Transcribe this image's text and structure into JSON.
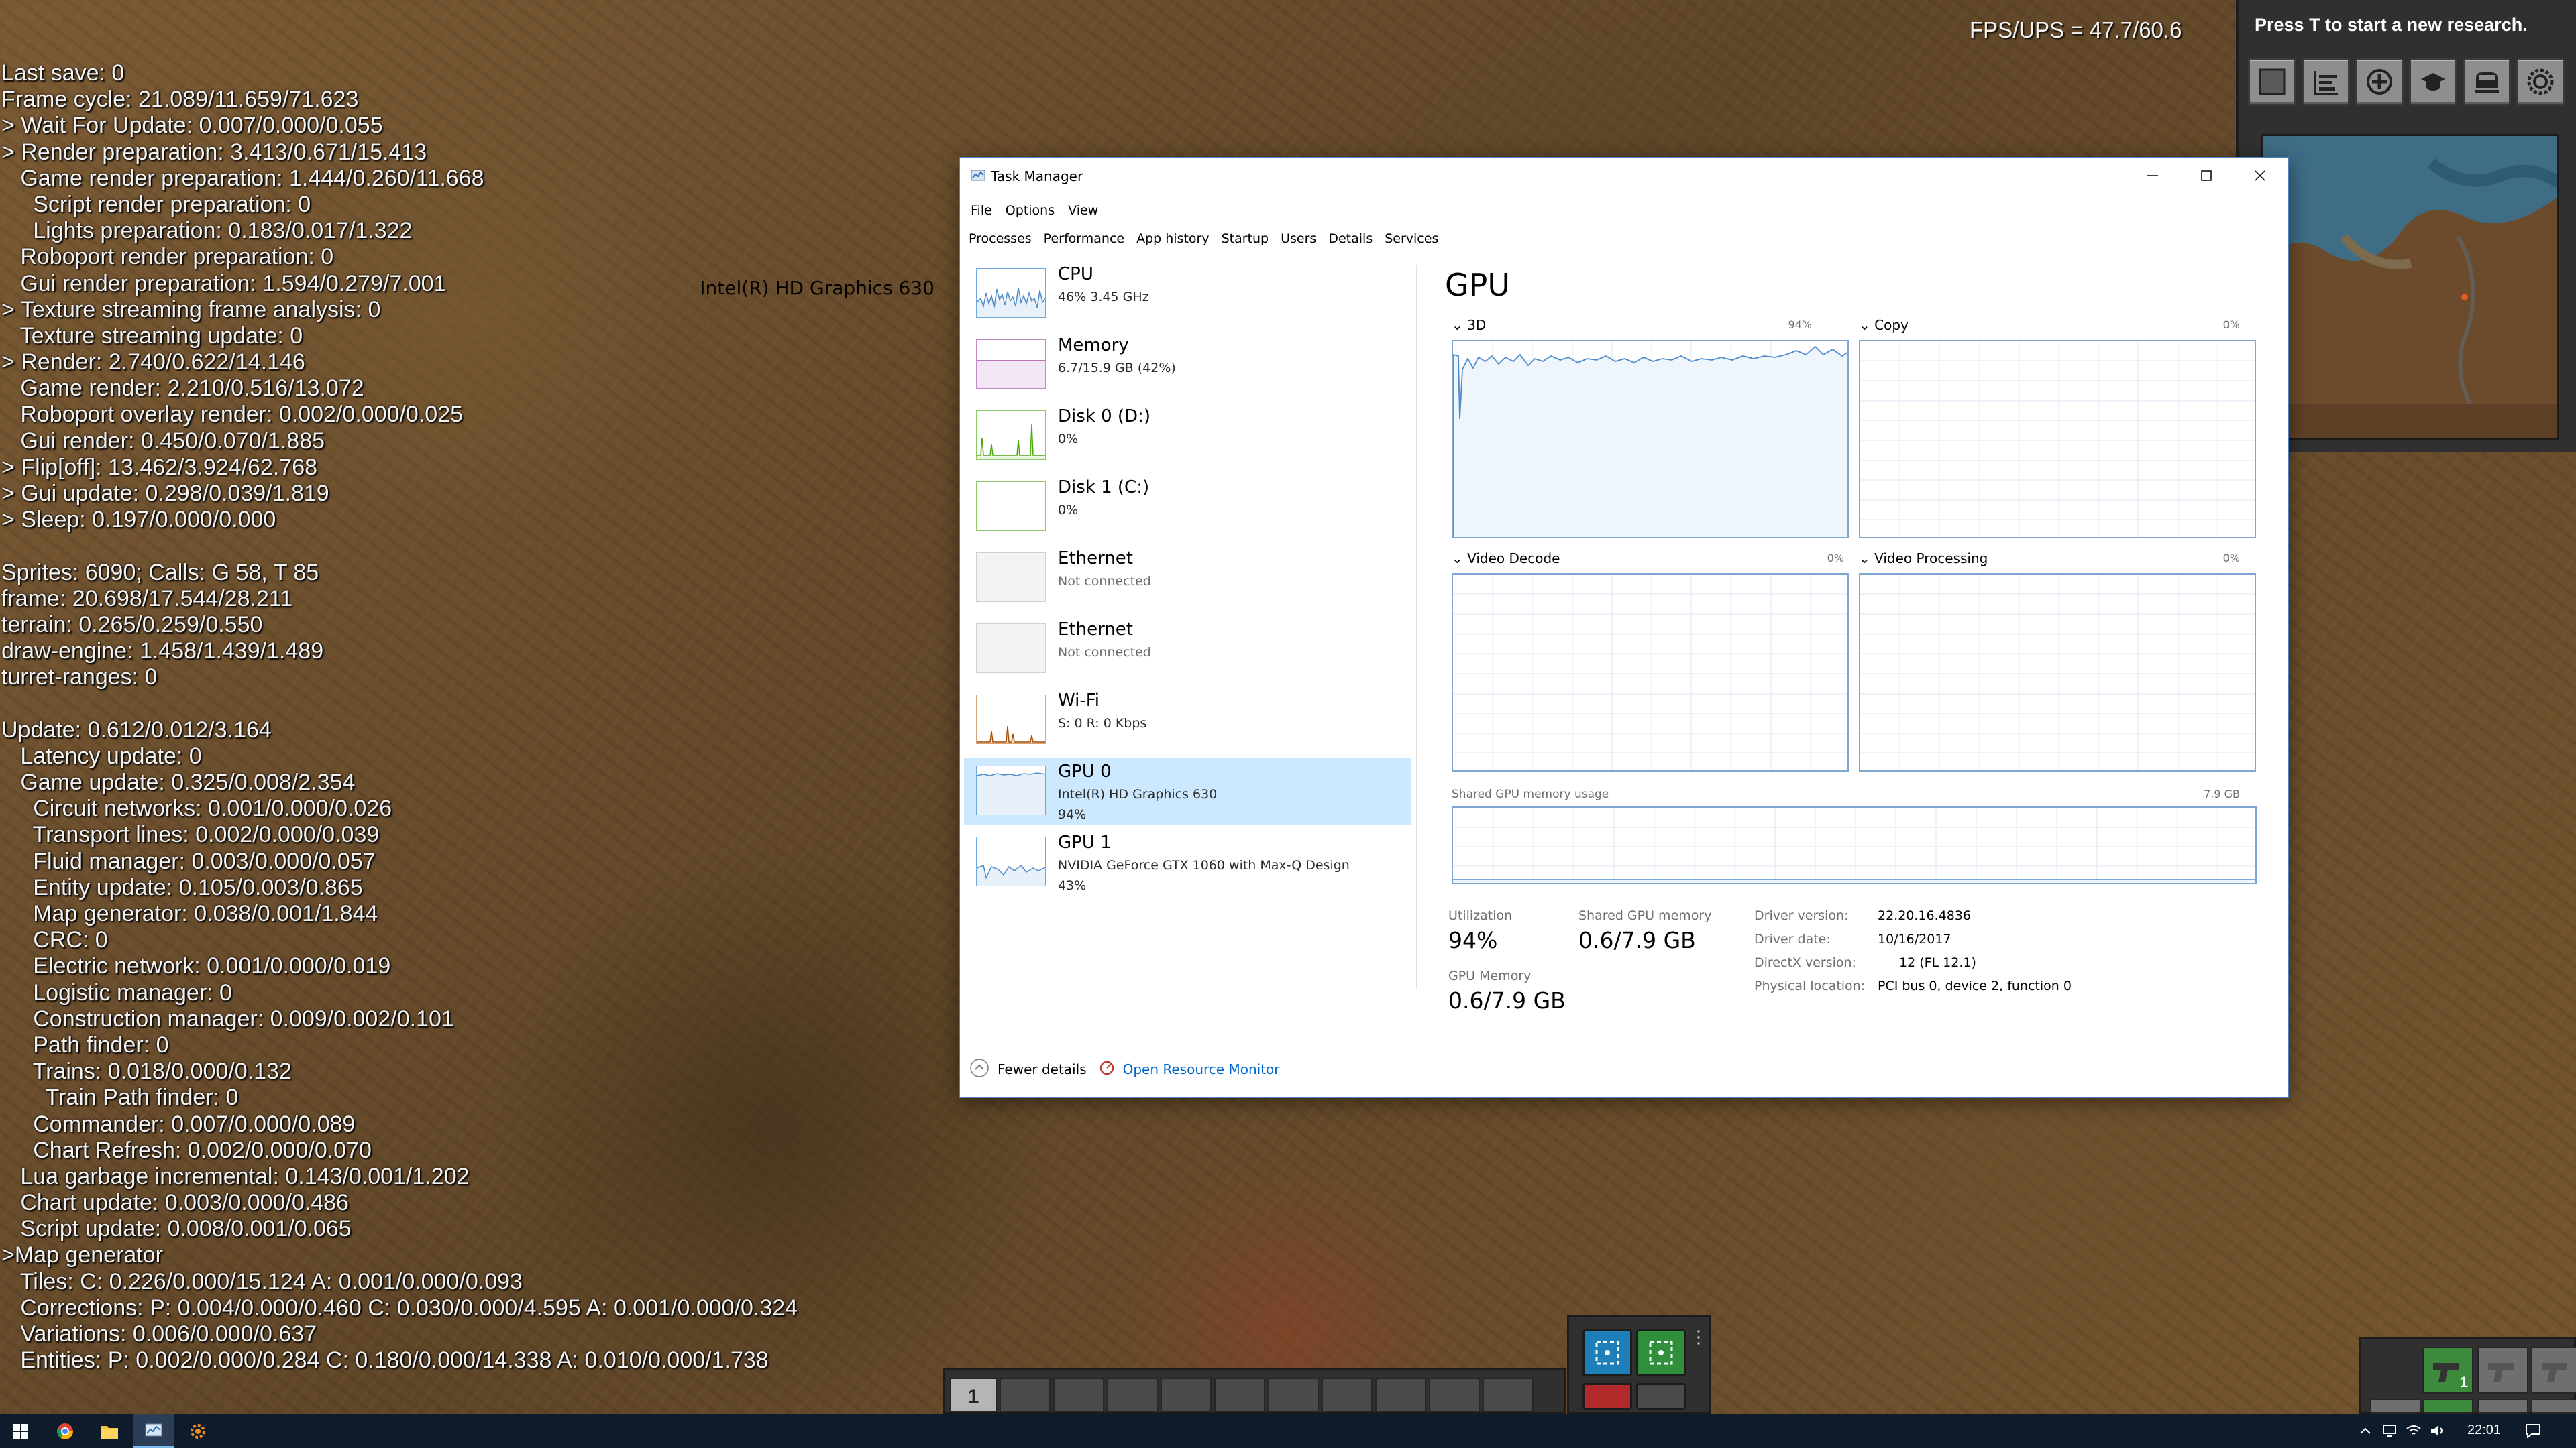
{
  "game": {
    "fps": "FPS/UPS = 47.7/60.6",
    "research_prompt": "Press T to start a new research.",
    "debug_lines": [
      "Last save: 0",
      "Frame cycle: 21.089/11.659/71.623",
      "> Wait For Update: 0.007/0.000/0.055",
      "> Render preparation: 3.413/0.671/15.413",
      "   Game render preparation: 1.444/0.260/11.668",
      "     Script render preparation: 0",
      "     Lights preparation: 0.183/0.017/1.322",
      "   Roboport render preparation: 0",
      "   Gui render preparation: 1.594/0.279/7.001",
      "> Texture streaming frame analysis: 0",
      "   Texture streaming update: 0",
      "> Render: 2.740/0.622/14.146",
      "   Game render: 2.210/0.516/13.072",
      "   Roboport overlay render: 0.002/0.000/0.025",
      "   Gui render: 0.450/0.070/1.885",
      "> Flip[off]: 13.462/3.924/62.768",
      "> Gui update: 0.298/0.039/1.819",
      "> Sleep: 0.197/0.000/0.000",
      "",
      "Sprites: 6090; Calls: G 58, T 85",
      "frame: 20.698/17.544/28.211",
      "terrain: 0.265/0.259/0.550",
      "draw-engine: 1.458/1.439/1.489",
      "turret-ranges: 0",
      "",
      "Update: 0.612/0.012/3.164",
      "   Latency update: 0",
      "   Game update: 0.325/0.008/2.354",
      "     Circuit networks: 0.001/0.000/0.026",
      "     Transport lines: 0.002/0.000/0.039",
      "     Fluid manager: 0.003/0.000/0.057",
      "     Entity update: 0.105/0.003/0.865",
      "     Map generator: 0.038/0.001/1.844",
      "     CRC: 0",
      "     Electric network: 0.001/0.000/0.019",
      "     Logistic manager: 0",
      "     Construction manager: 0.009/0.002/0.101",
      "     Path finder: 0",
      "     Trains: 0.018/0.000/0.132",
      "       Train Path finder: 0",
      "     Commander: 0.007/0.000/0.089",
      "     Chart Refresh: 0.002/0.000/0.070",
      "   Lua garbage incremental: 0.143/0.001/1.202",
      "   Chart update: 0.003/0.000/0.486",
      "   Script update: 0.008/0.001/0.065",
      ">Map generator",
      "   Tiles: C: 0.226/0.000/15.124 A: 0.001/0.000/0.093",
      "   Corrections: P: 0.004/0.000/0.460 C: 0.030/0.000/4.595 A: 0.001/0.000/0.324",
      "   Variations: 0.006/0.000/0.637",
      "   Entities: P: 0.002/0.000/0.284 C: 0.180/0.000/14.338 A: 0.010/0.000/1.738"
    ],
    "hud_icons": [
      "map-icon",
      "production-icon",
      "bonus-icon",
      "research-icon",
      "train-icon",
      "settings-gear-icon"
    ],
    "quickbar_first_slot": "1",
    "inventory_count": "1"
  },
  "task_manager": {
    "title": "Task Manager",
    "menu": [
      "File",
      "Options",
      "View"
    ],
    "tabs": [
      "Processes",
      "Performance",
      "App history",
      "Startup",
      "Users",
      "Details",
      "Services"
    ],
    "active_tab": "Performance",
    "devices": [
      {
        "name": "CPU",
        "line1": "46%  3.45 GHz",
        "line2": ""
      },
      {
        "name": "Memory",
        "line1": "6.7/15.9 GB (42%)",
        "line2": ""
      },
      {
        "name": "Disk 0 (D:)",
        "line1": "0%",
        "line2": ""
      },
      {
        "name": "Disk 1 (C:)",
        "line1": "0%",
        "line2": ""
      },
      {
        "name": "Ethernet",
        "line1": "Not connected",
        "line2": ""
      },
      {
        "name": "Ethernet",
        "line1": "Not connected",
        "line2": ""
      },
      {
        "name": "Wi-Fi",
        "line1": "S: 0  R: 0 Kbps",
        "line2": ""
      },
      {
        "name": "GPU 0",
        "line1": "Intel(R) HD Graphics 630",
        "line2": "94%"
      },
      {
        "name": "GPU 1",
        "line1": "NVIDIA GeForce GTX 1060 with Max-Q Design",
        "line2": "43%"
      }
    ],
    "gpu": {
      "title": "GPU",
      "model": "Intel(R) HD Graphics 630",
      "graphs": [
        {
          "label": "3D",
          "pct": "94%"
        },
        {
          "label": "Copy",
          "pct": "0%"
        },
        {
          "label": "Video Decode",
          "pct": "0%"
        },
        {
          "label": "Video Processing",
          "pct": "0%"
        }
      ],
      "shared_label": "Shared GPU memory usage",
      "shared_max": "7.9 GB",
      "utilization_label": "Utilization",
      "utilization": "94%",
      "shared_mem_label": "Shared GPU memory",
      "shared_mem": "0.6/7.9 GB",
      "gpu_mem_label": "GPU Memory",
      "gpu_mem": "0.6/7.9 GB",
      "details": [
        {
          "k": "Driver version:",
          "v": "22.20.16.4836"
        },
        {
          "k": "Driver date:",
          "v": "10/16/2017"
        },
        {
          "k": "DirectX version:",
          "v": "12 (FL 12.1)"
        },
        {
          "k": "Physical location:",
          "v": "PCI bus 0, device 2, function 0"
        }
      ]
    },
    "footer": {
      "fewer": "Fewer details",
      "resource_monitor": "Open Resource Monitor"
    }
  },
  "taskbar": {
    "clock": "22:01",
    "apps": [
      "windows-start-icon",
      "chrome-icon",
      "file-explorer-icon",
      "task-manager-icon",
      "factorio-icon"
    ]
  },
  "colors": {
    "graph_border": "#7fa5d2",
    "graph_line": "#4f8ccb",
    "selected_device": "#cce8ff",
    "link": "#0066cc",
    "memory": "#a24aa4",
    "disk": "#4da60c",
    "wifi": "#a74f01"
  }
}
